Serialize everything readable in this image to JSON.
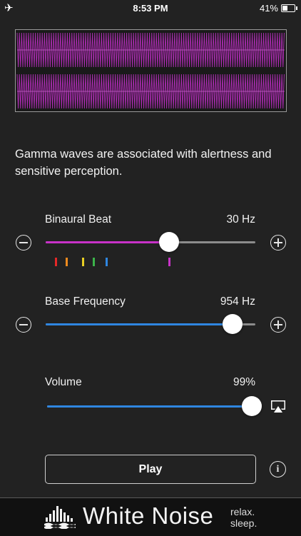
{
  "status_bar": {
    "time": "8:53 PM",
    "battery": "41%",
    "battery_level": 0.41
  },
  "description": "Gamma waves are associated with alertness and sensitive perception.",
  "binaural_beat": {
    "label": "Binaural Beat",
    "value": "30 Hz",
    "level": 0.59,
    "fill_color": "#c832c8"
  },
  "presets": [
    {
      "color": "#e52828",
      "level": 0.05
    },
    {
      "color": "#ee8a1e",
      "level": 0.1
    },
    {
      "color": "#e8cf24",
      "level": 0.18
    },
    {
      "color": "#3cb44a",
      "level": 0.23
    },
    {
      "color": "#2f86e0",
      "level": 0.29
    },
    {
      "color": "#c832c8",
      "level": 0.59
    }
  ],
  "base_frequency": {
    "label": "Base Frequency",
    "value": "954 Hz",
    "level": 0.89,
    "fill_color": "#2f86e0"
  },
  "volume": {
    "label": "Volume",
    "value": "99%",
    "level": 0.99,
    "fill_color": "#2f86e0"
  },
  "play_button": {
    "label": "Play"
  },
  "info_label": "i",
  "footer": {
    "brand": "White Noise",
    "tagline_line1": "relax.",
    "tagline_line2": "sleep."
  },
  "colors": {
    "background": "#222222",
    "wave": "#b22cb8",
    "accent_blue": "#2f86e0"
  },
  "icons": [
    "airplane-icon",
    "minus-icon",
    "plus-icon",
    "airplay-icon",
    "info-icon",
    "equalizer-logo-icon"
  ]
}
